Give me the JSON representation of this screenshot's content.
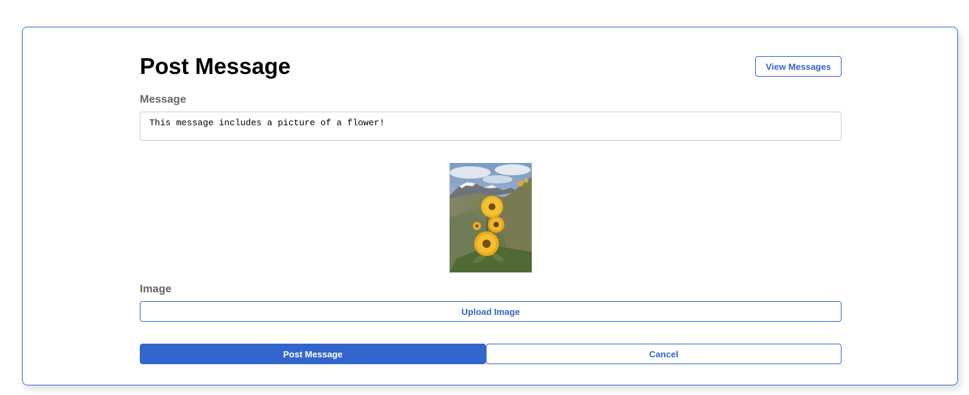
{
  "header": {
    "title": "Post Message",
    "view_messages_label": "View Messages"
  },
  "form": {
    "message_label": "Message",
    "message_value": "This message includes a picture of a flower!",
    "image_label": "Image",
    "upload_label": "Upload Image",
    "post_label": "Post Message",
    "cancel_label": "Cancel"
  },
  "theme": {
    "accent": "#3366cc",
    "label_color": "#666666"
  },
  "preview": {
    "subject": "flower-photo"
  }
}
